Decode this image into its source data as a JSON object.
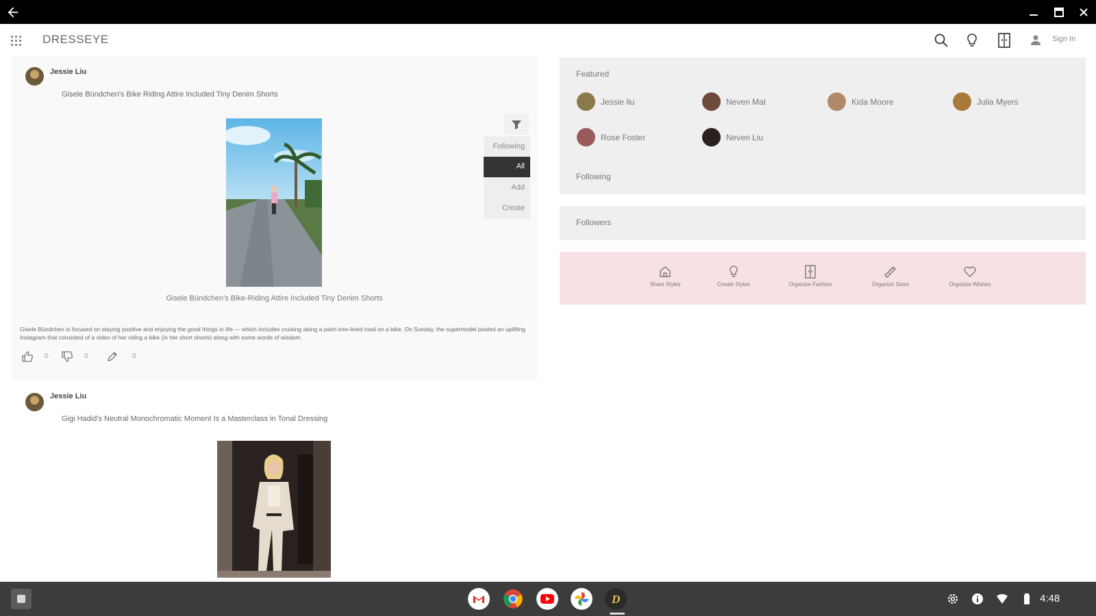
{
  "window": {
    "back_icon": "arrow-left-icon",
    "controls": [
      "minimize-icon",
      "maximize-icon",
      "close-icon"
    ]
  },
  "header": {
    "brand": "DRESSEYE",
    "icons": [
      "grid-menu-icon",
      "search-icon",
      "lightbulb-icon",
      "wardrobe-icon",
      "user-icon"
    ],
    "signin": "Sign In"
  },
  "filter": {
    "icon": "filter-icon",
    "items": [
      "Following",
      "All",
      "Add",
      "Create"
    ],
    "selected": "All"
  },
  "posts": [
    {
      "author": "Jessie Liu",
      "headline": "Gisele Bündchen's Bike Riding Attire Included Tiny Denim Shorts",
      "caption": "Gisele Bündchen's Bike-Riding Attire Included Tiny Denim Shorts",
      "body": "Gisele Bündchen is focused on staying positive and enjoying the good things in life — which includes cruising along a palm-tree-lined road on a bike. On Sunday, the supermodel posted an uplifting Instagram that consisted of a video of her riding a bike (in her short shorts) along with some words of wisdom.",
      "likes": "0",
      "dislikes": "0",
      "edits": "0"
    },
    {
      "author": "Jessie Liu",
      "headline": "Gigi Hadid's Neutral Monochromatic Moment Is a Masterclass in Tonal Dressing"
    }
  ],
  "sidebar": {
    "featured_title": "Featured",
    "featured": [
      {
        "name": "Jessie liu",
        "color": "#8a7a4a"
      },
      {
        "name": "Neven Mat",
        "color": "#6d4a3a"
      },
      {
        "name": "Kida Moore",
        "color": "#b08a6a"
      },
      {
        "name": "Julia Myers",
        "color": "#a87a3a"
      },
      {
        "name": "Rose Foster",
        "color": "#9a5a5a"
      },
      {
        "name": "Neven Liu",
        "color": "#2a2020"
      }
    ],
    "following_title": "Following",
    "followers_title": "Followers"
  },
  "features": [
    {
      "label": "Share Styles",
      "icon": "home-icon"
    },
    {
      "label": "Create Styles",
      "icon": "lightbulb-icon"
    },
    {
      "label": "Organize Fashion",
      "icon": "wardrobe-icon"
    },
    {
      "label": "Organize Sizes",
      "icon": "ruler-icon"
    },
    {
      "label": "Organize Wishes",
      "icon": "heart-icon"
    }
  ],
  "shelf": {
    "apps": [
      "gmail-icon",
      "chrome-icon",
      "youtube-icon",
      "photos-icon",
      "dresseye-icon"
    ],
    "status_icons": [
      "settings-icon",
      "info-icon",
      "wifi-icon",
      "battery-icon"
    ],
    "time": "4:48"
  }
}
